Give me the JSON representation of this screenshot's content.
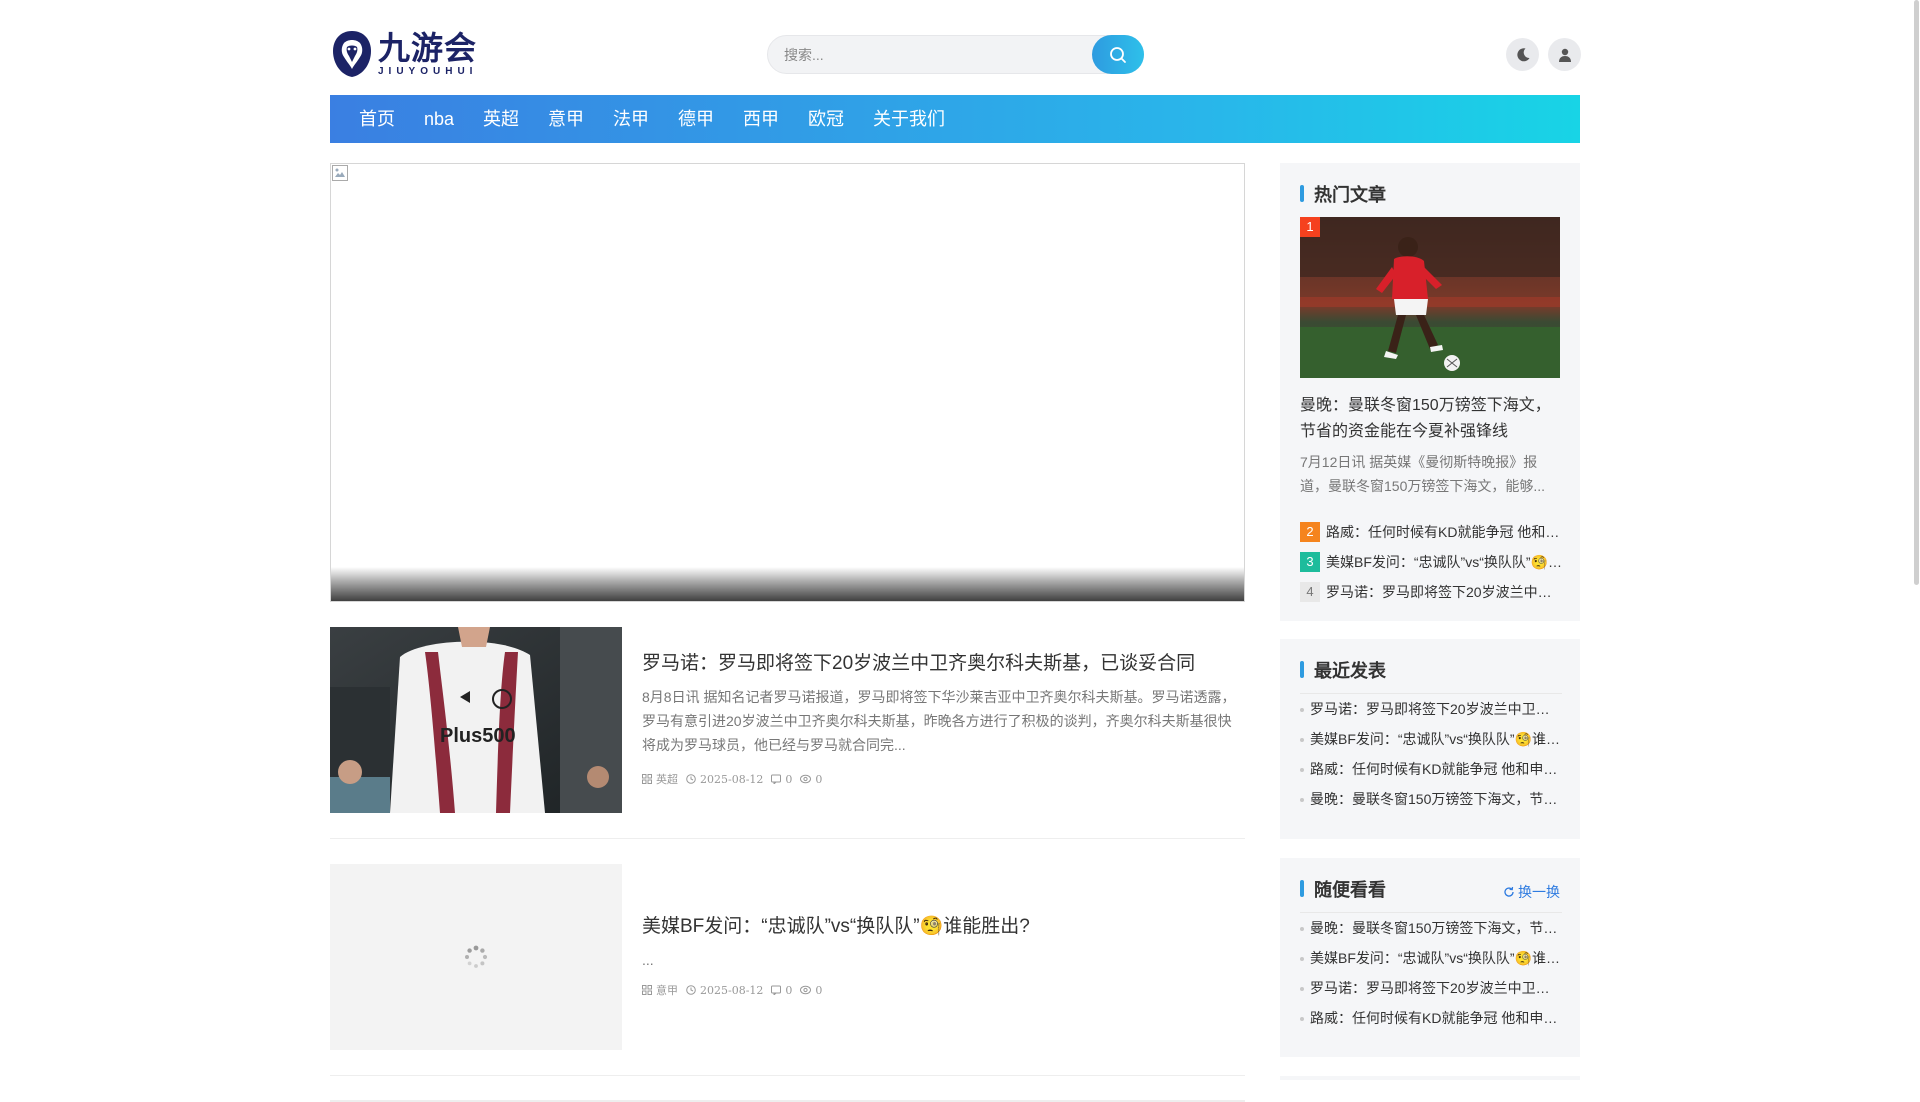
{
  "site": {
    "logo_cn": "九游会",
    "logo_en": "JIUYOUHUI"
  },
  "search": {
    "placeholder": "搜索..."
  },
  "nav": {
    "items": [
      "首页",
      "nba",
      "英超",
      "意甲",
      "法甲",
      "德甲",
      "西甲",
      "欧冠",
      "关于我们"
    ]
  },
  "posts": [
    {
      "title": "罗马诺：罗马即将签下20岁波兰中卫齐奥尔科夫斯基，已谈妥合同",
      "excerpt": "8月8日讯 据知名记者罗马诺报道，罗马即将签下华沙莱吉亚中卫齐奥尔科夫斯基。罗马诺透露，罗马有意引进20岁波兰中卫齐奥尔科夫斯基，昨晚各方进行了积极的谈判，齐奥尔科夫斯基很快将成为罗马球员，他已经与罗马就合同完...",
      "category": "英超",
      "date": "2025-08-12",
      "comments": "0",
      "views": "0"
    },
    {
      "title": "美媒BF发问：“忠诚队”vs“换队队”🧐谁能胜出?",
      "excerpt": "...",
      "category": "意甲",
      "date": "2025-08-12",
      "comments": "0",
      "views": "0"
    }
  ],
  "sidebar": {
    "hot": {
      "title": "热门文章",
      "top": {
        "rank": "1",
        "title": "曼晚：曼联冬窗150万镑签下海文，节省的资金能在今夏补强锋线",
        "excerpt": "7月12日讯 据英媒《曼彻斯特晚报》报道，曼联冬窗150万镑签下海文，能够..."
      },
      "items": [
        {
          "rank": "2",
          "title": "路威：任何时候有KD就能争冠 他和申京都有得分能力"
        },
        {
          "rank": "3",
          "title": "美媒BF发问：“忠诚队”vs“换队队”🧐谁能胜出?"
        },
        {
          "rank": "4",
          "title": "罗马诺：罗马即将签下20岁波兰中卫齐奥尔科夫斯基，已谈妥合同"
        }
      ],
      "rank_colors": [
        "#f5411e",
        "#f5841e",
        "#1ebc9c",
        "#e8e8e8"
      ]
    },
    "recent": {
      "title": "最近发表",
      "items": [
        "罗马诺：罗马即将签下20岁波兰中卫齐奥尔科夫斯基，已谈妥合同",
        "美媒BF发问：“忠诚队”vs“换队队”🧐谁能胜出?",
        "路威：任何时候有KD就能争冠 他和申京都有得分能力",
        "曼晚：曼联冬窗150万镑签下海文，节省的资金能在今夏补强锋线"
      ]
    },
    "random": {
      "title": "随便看看",
      "refresh_label": "换一换",
      "items": [
        "曼晚：曼联冬窗150万镑签下海文，节省的资金能在今夏补强锋线",
        "美媒BF发问：“忠诚队”vs“换队队”🧐谁能胜出?",
        "罗马诺：罗马即将签下20岁波兰中卫齐奥尔科夫斯基，已谈妥合同",
        "路威：任何时候有KD就能争冠 他和申京都有得分能力"
      ]
    }
  },
  "icons": {
    "search": "search-icon",
    "theme": "moon-icon",
    "user": "user-icon",
    "category": "grid-icon",
    "date": "clock-icon",
    "comments": "comment-icon",
    "views": "eye-icon",
    "refresh": "refresh-icon"
  },
  "colors": {
    "accent": "#2e9be0",
    "nav_start": "#3a7fe2",
    "nav_end": "#18d4e6",
    "logo": "#1c2366"
  }
}
